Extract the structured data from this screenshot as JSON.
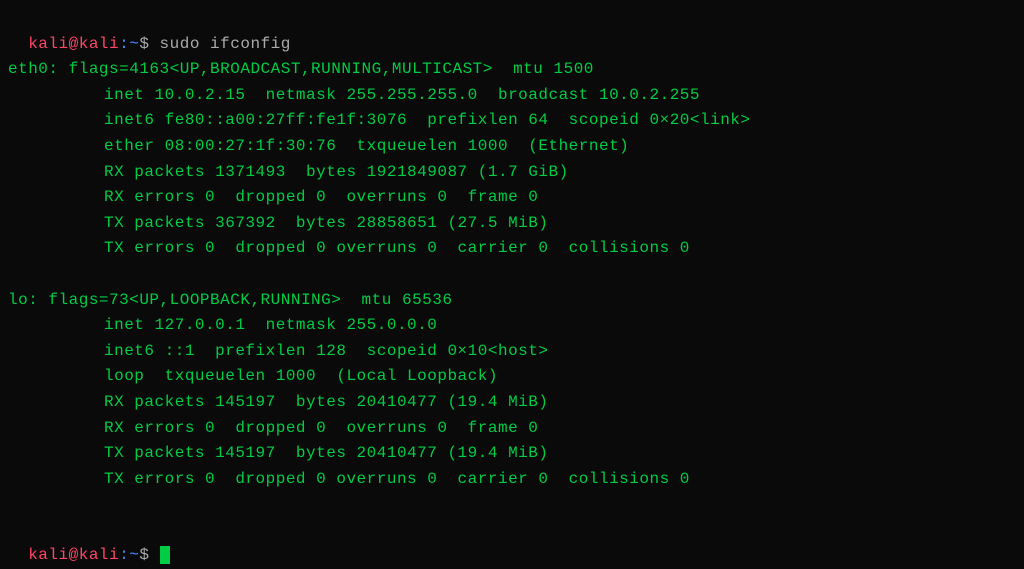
{
  "prompt": {
    "user": "kali",
    "at": "@",
    "host": "kali",
    "sep": ":",
    "path": "~",
    "dollar": "$ "
  },
  "command1": "sudo ifconfig",
  "eth0": {
    "header": "eth0: flags=4163<UP,BROADCAST,RUNNING,MULTICAST>  mtu 1500",
    "inet": "inet 10.0.2.15  netmask 255.255.255.0  broadcast 10.0.2.255",
    "inet6": "inet6 fe80::a00:27ff:fe1f:3076  prefixlen 64  scopeid 0×20<link>",
    "ether": "ether 08:00:27:1f:30:76  txqueuelen 1000  (Ethernet)",
    "rxpackets": "RX packets 1371493  bytes 1921849087 (1.7 GiB)",
    "rxerrors": "RX errors 0  dropped 0  overruns 0  frame 0",
    "txpackets": "TX packets 367392  bytes 28858651 (27.5 MiB)",
    "txerrors": "TX errors 0  dropped 0 overruns 0  carrier 0  collisions 0"
  },
  "lo": {
    "header": "lo: flags=73<UP,LOOPBACK,RUNNING>  mtu 65536",
    "inet": "inet 127.0.0.1  netmask 255.0.0.0",
    "inet6": "inet6 ::1  prefixlen 128  scopeid 0×10<host>",
    "loop": "loop  txqueuelen 1000  (Local Loopback)",
    "rxpackets": "RX packets 145197  bytes 20410477 (19.4 MiB)",
    "rxerrors": "RX errors 0  dropped 0  overruns 0  frame 0",
    "txpackets": "TX packets 145197  bytes 20410477 (19.4 MiB)",
    "txerrors": "TX errors 0  dropped 0 overruns 0  carrier 0  collisions 0"
  }
}
